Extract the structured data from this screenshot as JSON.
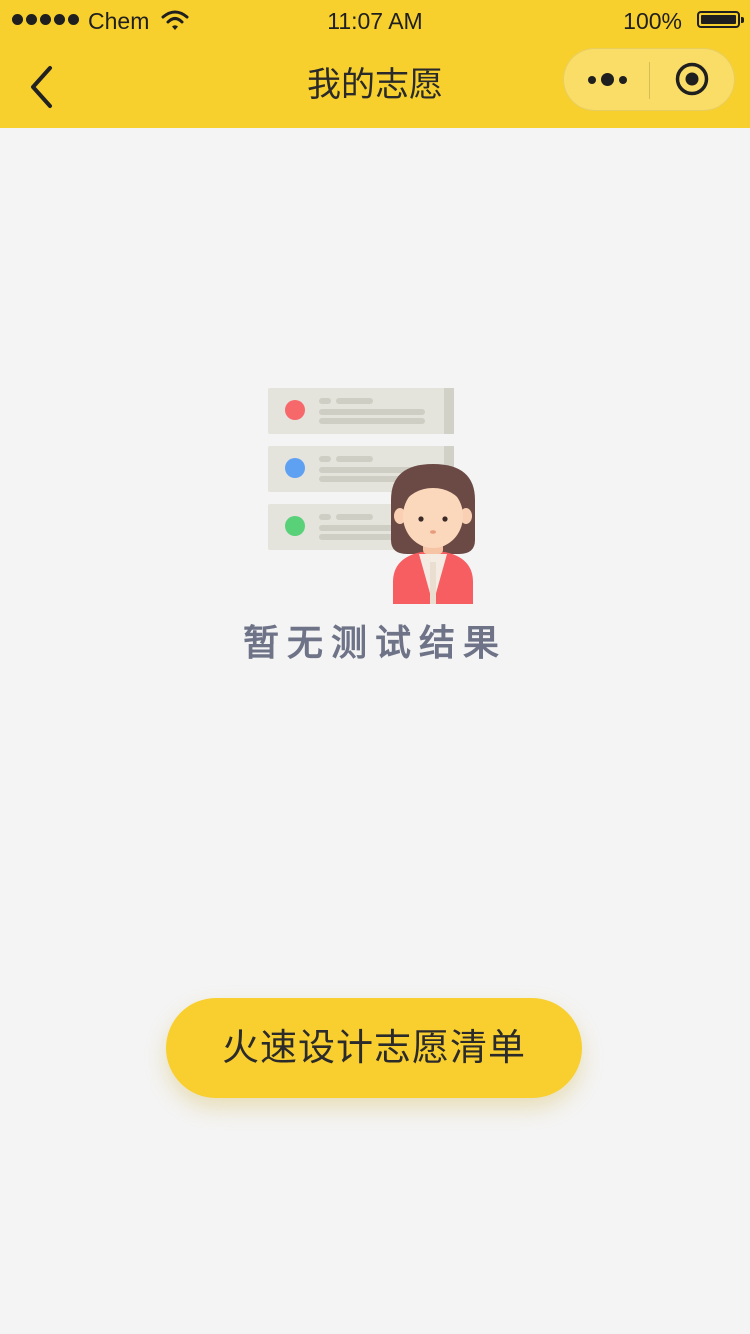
{
  "status_bar": {
    "carrier": "Chem",
    "time": "11:07 AM",
    "battery": "100%"
  },
  "nav": {
    "title": "我的志愿",
    "back_icon": "chevron-left-icon",
    "menu_icon": "more-dots-icon",
    "close_icon": "target-circle-icon"
  },
  "empty_state": {
    "message": "暂无测试结果",
    "illustration": "list-cards-with-girl"
  },
  "cta": {
    "label": "火速设计志愿清单"
  },
  "colors": {
    "brand_yellow": "#f8d02d",
    "background": "#f4f4f4",
    "empty_text": "#6e7387",
    "dot_red": "#f6686a",
    "dot_blue": "#5ea1f3",
    "dot_green": "#58d179"
  }
}
